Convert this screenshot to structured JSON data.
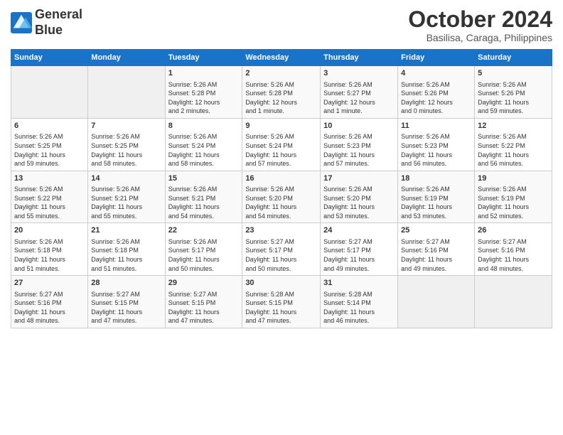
{
  "logo": {
    "line1": "General",
    "line2": "Blue"
  },
  "title": "October 2024",
  "subtitle": "Basilisa, Caraga, Philippines",
  "days_header": [
    "Sunday",
    "Monday",
    "Tuesday",
    "Wednesday",
    "Thursday",
    "Friday",
    "Saturday"
  ],
  "weeks": [
    [
      {
        "num": "",
        "info": ""
      },
      {
        "num": "",
        "info": ""
      },
      {
        "num": "1",
        "info": "Sunrise: 5:26 AM\nSunset: 5:28 PM\nDaylight: 12 hours\nand 2 minutes."
      },
      {
        "num": "2",
        "info": "Sunrise: 5:26 AM\nSunset: 5:28 PM\nDaylight: 12 hours\nand 1 minute."
      },
      {
        "num": "3",
        "info": "Sunrise: 5:26 AM\nSunset: 5:27 PM\nDaylight: 12 hours\nand 1 minute."
      },
      {
        "num": "4",
        "info": "Sunrise: 5:26 AM\nSunset: 5:26 PM\nDaylight: 12 hours\nand 0 minutes."
      },
      {
        "num": "5",
        "info": "Sunrise: 5:26 AM\nSunset: 5:26 PM\nDaylight: 11 hours\nand 59 minutes."
      }
    ],
    [
      {
        "num": "6",
        "info": "Sunrise: 5:26 AM\nSunset: 5:25 PM\nDaylight: 11 hours\nand 59 minutes."
      },
      {
        "num": "7",
        "info": "Sunrise: 5:26 AM\nSunset: 5:25 PM\nDaylight: 11 hours\nand 58 minutes."
      },
      {
        "num": "8",
        "info": "Sunrise: 5:26 AM\nSunset: 5:24 PM\nDaylight: 11 hours\nand 58 minutes."
      },
      {
        "num": "9",
        "info": "Sunrise: 5:26 AM\nSunset: 5:24 PM\nDaylight: 11 hours\nand 57 minutes."
      },
      {
        "num": "10",
        "info": "Sunrise: 5:26 AM\nSunset: 5:23 PM\nDaylight: 11 hours\nand 57 minutes."
      },
      {
        "num": "11",
        "info": "Sunrise: 5:26 AM\nSunset: 5:23 PM\nDaylight: 11 hours\nand 56 minutes."
      },
      {
        "num": "12",
        "info": "Sunrise: 5:26 AM\nSunset: 5:22 PM\nDaylight: 11 hours\nand 56 minutes."
      }
    ],
    [
      {
        "num": "13",
        "info": "Sunrise: 5:26 AM\nSunset: 5:22 PM\nDaylight: 11 hours\nand 55 minutes."
      },
      {
        "num": "14",
        "info": "Sunrise: 5:26 AM\nSunset: 5:21 PM\nDaylight: 11 hours\nand 55 minutes."
      },
      {
        "num": "15",
        "info": "Sunrise: 5:26 AM\nSunset: 5:21 PM\nDaylight: 11 hours\nand 54 minutes."
      },
      {
        "num": "16",
        "info": "Sunrise: 5:26 AM\nSunset: 5:20 PM\nDaylight: 11 hours\nand 54 minutes."
      },
      {
        "num": "17",
        "info": "Sunrise: 5:26 AM\nSunset: 5:20 PM\nDaylight: 11 hours\nand 53 minutes."
      },
      {
        "num": "18",
        "info": "Sunrise: 5:26 AM\nSunset: 5:19 PM\nDaylight: 11 hours\nand 53 minutes."
      },
      {
        "num": "19",
        "info": "Sunrise: 5:26 AM\nSunset: 5:19 PM\nDaylight: 11 hours\nand 52 minutes."
      }
    ],
    [
      {
        "num": "20",
        "info": "Sunrise: 5:26 AM\nSunset: 5:18 PM\nDaylight: 11 hours\nand 51 minutes."
      },
      {
        "num": "21",
        "info": "Sunrise: 5:26 AM\nSunset: 5:18 PM\nDaylight: 11 hours\nand 51 minutes."
      },
      {
        "num": "22",
        "info": "Sunrise: 5:26 AM\nSunset: 5:17 PM\nDaylight: 11 hours\nand 50 minutes."
      },
      {
        "num": "23",
        "info": "Sunrise: 5:27 AM\nSunset: 5:17 PM\nDaylight: 11 hours\nand 50 minutes."
      },
      {
        "num": "24",
        "info": "Sunrise: 5:27 AM\nSunset: 5:17 PM\nDaylight: 11 hours\nand 49 minutes."
      },
      {
        "num": "25",
        "info": "Sunrise: 5:27 AM\nSunset: 5:16 PM\nDaylight: 11 hours\nand 49 minutes."
      },
      {
        "num": "26",
        "info": "Sunrise: 5:27 AM\nSunset: 5:16 PM\nDaylight: 11 hours\nand 48 minutes."
      }
    ],
    [
      {
        "num": "27",
        "info": "Sunrise: 5:27 AM\nSunset: 5:16 PM\nDaylight: 11 hours\nand 48 minutes."
      },
      {
        "num": "28",
        "info": "Sunrise: 5:27 AM\nSunset: 5:15 PM\nDaylight: 11 hours\nand 47 minutes."
      },
      {
        "num": "29",
        "info": "Sunrise: 5:27 AM\nSunset: 5:15 PM\nDaylight: 11 hours\nand 47 minutes."
      },
      {
        "num": "30",
        "info": "Sunrise: 5:28 AM\nSunset: 5:15 PM\nDaylight: 11 hours\nand 47 minutes."
      },
      {
        "num": "31",
        "info": "Sunrise: 5:28 AM\nSunset: 5:14 PM\nDaylight: 11 hours\nand 46 minutes."
      },
      {
        "num": "",
        "info": ""
      },
      {
        "num": "",
        "info": ""
      }
    ]
  ]
}
